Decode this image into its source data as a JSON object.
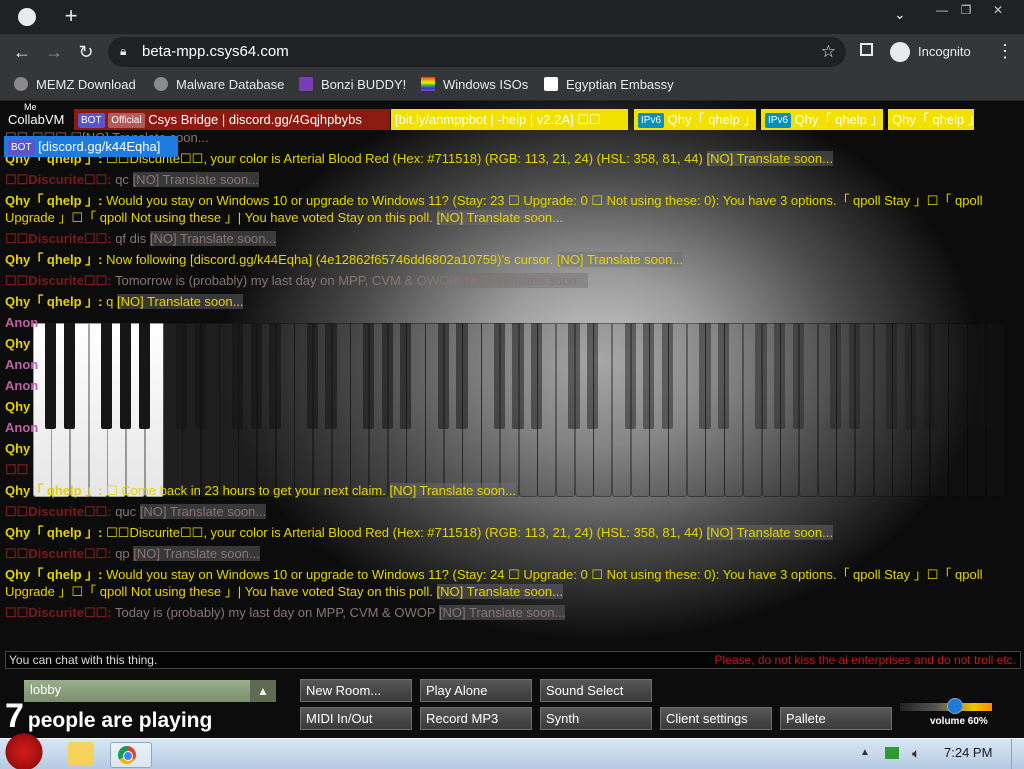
{
  "browser": {
    "new_tab_glyph": "+",
    "tab_search_glyph": "⌄",
    "window_buttons": [
      "—",
      "❐",
      "✕"
    ],
    "url": "beta-mpp.csys64.com",
    "incognito_label": "Incognito",
    "bookmarks": [
      {
        "label": "MEMZ Download",
        "icon": "globe-icon"
      },
      {
        "label": "Malware Database",
        "icon": "globe-icon"
      },
      {
        "label": "Bonzi BUDDY!",
        "icon": "bonzi-icon"
      },
      {
        "label": "Windows ISOs",
        "icon": "rainbow-flag-icon"
      },
      {
        "label": "Egyptian Embassy",
        "icon": "wix-icon"
      }
    ]
  },
  "participants": [
    {
      "name": "CollabVM",
      "prefix": "Me"
    },
    {
      "tags": [
        "BOT",
        "Official"
      ],
      "name": "Csys Bridge | discord.gg/4Gqjhpbybs"
    },
    {
      "name": "[bit.ly/anmppbot | -help | v2.2A] ☐☐"
    },
    {
      "tags": [
        "IPv6"
      ],
      "name": "Qhy「 qhelp 」"
    },
    {
      "tags": [
        "IPv6"
      ],
      "name": "Qhy「 qhelp 」"
    },
    {
      "name": "Qhy「 qhelp 」"
    },
    {
      "tags": [
        "BOT"
      ],
      "name": "[discord.gg/k44Eqha]"
    }
  ],
  "chat": [
    {
      "name": "",
      "text": "☐☐ ☐☐☐ ☐[NO] Translate soon..."
    },
    {
      "name": "Qhy「 qhelp 」:",
      "text": "☐☐Discurite☐☐, your color is Arterial Blood Red (Hex: #711518) (RGB: 113, 21, 24) (HSL: 358, 81, 44)",
      "translate": "[NO] Translate soon..."
    },
    {
      "name": "☐☐Discurite☐☐:",
      "text": "qc",
      "translate": "[NO] Translate soon..."
    },
    {
      "name": "Qhy「 qhelp 」:",
      "text": "Would you stay on Windows 10 or upgrade to Windows 11? (Stay: 23 ☐ Upgrade: 0 ☐ Not using these: 0): You have 3 options.「 qpoll Stay 」☐「 qpoll Upgrade 」☐「 qpoll Not using these 」| You have voted Stay on this poll.",
      "translate": "[NO] Translate soon..."
    },
    {
      "name": "☐☐Discurite☐☐:",
      "text": "qf dis",
      "translate": "[NO] Translate soon..."
    },
    {
      "name": "Qhy「 qhelp 」:",
      "text": "Now following [discord.gg/k44Eqha] (4e12862f65746dd6802a10759)'s cursor.",
      "translate": "[NO] Translate soon..."
    },
    {
      "name": "☐☐Discurite☐☐:",
      "text": "Tomorrow is (probably) my last day on MPP, CVM & OWOP",
      "translate": "[NO] Translate soon..."
    },
    {
      "name": "Qhy「 qhelp 」:",
      "text": "q",
      "translate": "[NO] Translate soon..."
    },
    {
      "name": "Anon",
      "text": ""
    },
    {
      "name": "Qhy",
      "text": ""
    },
    {
      "name": "Anon",
      "text": ""
    },
    {
      "name": "Anon",
      "text": ""
    },
    {
      "name": "Qhy",
      "text": ""
    },
    {
      "name": "Anon",
      "text": ""
    },
    {
      "name": "Qhy",
      "text": ""
    },
    {
      "name": "☐☐",
      "text": ""
    },
    {
      "name": "Qhy「 qhelp 」:",
      "text": "☐ Come back in 23 hours to get your next claim.",
      "translate": "[NO] Translate soon..."
    },
    {
      "name": "☐☐Discurite☐☐:",
      "text": "quc",
      "translate": "[NO] Translate soon..."
    },
    {
      "name": "Qhy「 qhelp 」:",
      "text": "☐☐Discurite☐☐, your color is Arterial Blood Red (Hex: #711518) (RGB: 113, 21, 24) (HSL: 358, 81, 44)",
      "translate": "[NO] Translate soon..."
    },
    {
      "name": "☐☐Discurite☐☐:",
      "text": "qp",
      "translate": "[NO] Translate soon..."
    },
    {
      "name": "Qhy「 qhelp 」:",
      "text": "Would you stay on Windows 10 or upgrade to Windows 11? (Stay: 24 ☐ Upgrade: 0 ☐ Not using these: 0): You have 3 options.「 qpoll Stay 」☐「 qpoll Upgrade 」☐「 qpoll Not using these 」| You have voted Stay on this poll.",
      "translate": "[NO] Translate soon..."
    },
    {
      "name": "☐☐Discurite☐☐:",
      "text": "Today is (probably) my last day on MPP, CVM & OWOP",
      "translate": "[NO] Translate soon..."
    }
  ],
  "chat_input": {
    "placeholder": "You can chat with this thing.",
    "warning": "Please, do not kiss the ai enterprises and do not troll etc."
  },
  "room": {
    "name": "lobby"
  },
  "players": {
    "count": "7",
    "label": "people are playing"
  },
  "buttons": {
    "new_room": "New Room...",
    "play_alone": "Play Alone",
    "sound_select": "Sound Select",
    "midi": "MIDI In/Out",
    "record": "Record MP3",
    "synth": "Synth",
    "client_settings": "Client settings",
    "pallete": "Pallete"
  },
  "volume": {
    "label": "volume 60%",
    "level": 0.6
  },
  "taskbar": {
    "clock": "7:24 PM"
  },
  "colors": {
    "participant_orange": "#8b1a10",
    "participant_gold": "#f2e000",
    "participant_blue": "#1e7be0",
    "chat_name_yellow": "#e5d200",
    "chat_name_red": "#7a1b1b",
    "chat_name_pink": "#c060a8"
  }
}
